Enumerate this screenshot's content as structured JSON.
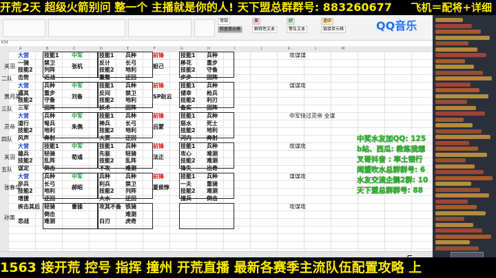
{
  "top_banner": {
    "marquee": "开荒2天 超级火箭别问 整一个 主播就是你的人! 天下盟总群群号: 883260677",
    "right": "飞机＝配将+详细"
  },
  "spreadsheet": {
    "name_box": "K34",
    "style_boxes": [
      "常规",
      "差",
      "好",
      "适中",
      "检查单元格",
      "解释性文本",
      "警告文本",
      "链接单元格"
    ],
    "column_headers": [
      "A",
      "B",
      "C",
      "D",
      "E",
      "F",
      "G",
      "H",
      "I",
      "J",
      "K",
      "L",
      "M"
    ],
    "teams": [
      {
        "row_label": "",
        "general": "关羽",
        "col1": [
          "大营",
          "一骑",
          "技能2",
          "击势"
        ],
        "col2": [
          "技能1",
          "禁卫",
          "列阵",
          "近战"
        ],
        "col3": [
          "中军",
          "张机",
          ""
        ],
        "col4": [
          "技能1",
          "反计",
          "技能2",
          "重整"
        ],
        "col5": [
          "兵种",
          "长弓",
          "地利",
          "迂回"
        ],
        "col6": [
          "前锋",
          "妲己"
        ],
        "col7": [
          "技能1",
          "移花",
          "技能2",
          "步步"
        ],
        "col8": [
          "兵种",
          "重步",
          "守备",
          "固阵"
        ],
        "note": "攻谋谋"
      },
      {
        "row_label": "二队",
        "general": "黄月英",
        "col1": [
          "大营",
          "遁其",
          "技能2",
          "三军"
        ],
        "col2": [
          "兵种",
          "重步",
          "守备",
          "固阵"
        ],
        "col3": [
          "中军",
          "刘备",
          ""
        ],
        "col4": [
          "技能1",
          "反间",
          "技能2",
          "妖术"
        ],
        "col5": [
          "兵种",
          "禁卫",
          "地利",
          "固阵"
        ],
        "col6": [
          "前锋",
          "SP赵云"
        ],
        "col7": [
          "技能1",
          "储幸",
          "技能2",
          "备实"
        ],
        "col8": [
          "兵种",
          "枪兵",
          "利刃",
          "固阵"
        ],
        "note": "谋谋攻"
      },
      {
        "row_label": "三队",
        "general": "灵帝",
        "col1": [
          "大营",
          "道行",
          "技能2",
          "风声"
        ],
        "col2": [
          "兵种",
          "弩兵",
          "地利",
          "奔射"
        ],
        "col3": [
          "中军",
          "朱儁",
          ""
        ],
        "col4": [
          "技能1",
          "神兵",
          "技能2",
          "大赏"
        ],
        "col5": [
          "兵种",
          "长弓",
          "地利",
          "迂回"
        ],
        "col6": [
          "前锋",
          "吕蒙"
        ],
        "col7": [
          "技能1",
          "惩水",
          "技能2",
          "河内"
        ],
        "col8": [
          "兵种",
          "死士",
          "地利",
          "奔射"
        ],
        "note": "中军快过灵帝 全谋"
      },
      {
        "row_label": "四队",
        "general": "关羽",
        "col1": [
          "大营",
          "雄兵",
          "技能2",
          "谋定"
        ],
        "col2": [
          "技能1",
          "轻骑",
          "乱阵",
          "倒击"
        ],
        "col3": [
          "中军",
          "荀彧",
          ""
        ],
        "col4": [
          "技能1",
          "先驱",
          "技能2",
          "不攻"
        ],
        "col5": [
          "兵种",
          "轻骑",
          "乱阵",
          "难测"
        ],
        "col6": [
          "前锋",
          "法正"
        ],
        "col7": [
          "技能1",
          "攻心",
          "技能2",
          "锋失"
        ],
        "col8": [
          "兵种",
          "难测",
          "难测",
          "出奇"
        ],
        "note": "攻谋攻"
      },
      {
        "row_label": "五队",
        "general": "张春华",
        "col1": [
          "大营",
          "毕兵",
          "技能2",
          "增援"
        ],
        "col2": [
          "兵种",
          "长弓",
          "地利",
          "迂回"
        ],
        "col3": [
          "中军",
          "郝昭",
          ""
        ],
        "col4": [
          "兵种",
          "利兵",
          "技能2",
          "大水"
        ],
        "col5": [
          "兵种",
          "禁卫",
          "列阵",
          "迂回"
        ],
        "col6": [
          "前锋",
          "夏侯惇"
        ],
        "col7": [
          "技能1",
          "一夫",
          "技能2",
          "撞兵"
        ],
        "col8": [
          "兵种",
          "重骑",
          "难测",
          "倒击"
        ],
        "note": "谋谋攻"
      },
      {
        "row_label": "",
        "general": "孙策",
        "col1": [
          "疾击其后",
          "",
          "恋战"
        ],
        "col2": [
          "轻骑",
          "倒击",
          "难测"
        ],
        "col3": [
          "曹操"
        ],
        "col4": [
          "攻其不备",
          "",
          "白刃"
        ],
        "col5": [
          "铁骑",
          "难测",
          "虎奇"
        ],
        "col6": [
          ""
        ],
        "col7": [
          ""
        ],
        "col8": [
          ""
        ],
        "note": "攻谋攻"
      }
    ]
  },
  "overlay_text": {
    "qq_logo": "QQ音乐",
    "lines": [
      "中奖水友加QQ: 125",
      "b站、西瓜: 教练我想",
      "叉哥抖音 : 率土银行",
      "闻盟吹水总群群号: 6",
      "水友交流企鹅2群: 10",
      "天下盟总群群号:  88"
    ]
  },
  "bottom_banner": {
    "text": "1563  接开荒 控号 指挥 撞州 开荒直播 最新各赛季主流队伍配置攻略 上"
  },
  "colors": {
    "banner_yellow": "#ffeb00",
    "overlay_green": "#21c321",
    "header_blue": "#1a3fc8",
    "header_green": "#1e9b3c",
    "header_red": "#d11111"
  }
}
